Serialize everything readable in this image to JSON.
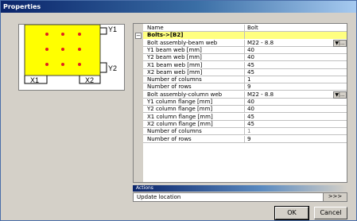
{
  "window": {
    "title": "Properties"
  },
  "diagram": {
    "labels": {
      "y1": "Y1",
      "y2": "Y2",
      "x1": "X1",
      "x2": "X2"
    },
    "colors": {
      "plate": "#ffff00",
      "bolt": "#e02020"
    }
  },
  "properties": {
    "header": {
      "name": "Name",
      "value": "Bolt"
    },
    "rows": [
      {
        "name": "Bolts->[B2]",
        "value": "",
        "group": true
      },
      {
        "name": "Bolt assembly-beam web",
        "value": "M22 - 8.8",
        "dropdown": true
      },
      {
        "name": "Y1 beam web [mm]",
        "value": "40"
      },
      {
        "name": "Y2 beam web [mm]",
        "value": "40"
      },
      {
        "name": "X1 beam web [mm]",
        "value": "45"
      },
      {
        "name": "X2 beam web [mm]",
        "value": "45"
      },
      {
        "name": "Number of columns",
        "value": "1"
      },
      {
        "name": "Number of rows",
        "value": "9"
      },
      {
        "name": "Bolt assembly-column web",
        "value": "M22 - 8.8",
        "dropdown": true
      },
      {
        "name": "Y1 column flange [mm]",
        "value": "40"
      },
      {
        "name": "Y2 column flange [mm]",
        "value": "40"
      },
      {
        "name": "X1 column flange [mm]",
        "value": "45"
      },
      {
        "name": "X2 column flange [mm]",
        "value": "45"
      },
      {
        "name": "Number of columns",
        "value": "1",
        "muted": true
      },
      {
        "name": "Number of rows",
        "value": "9"
      }
    ],
    "dropdown_label": "▼|..."
  },
  "actions": {
    "header": "Actions",
    "item_label": "Update location",
    "more_label": ">>>"
  },
  "buttons": {
    "ok": "OK",
    "cancel": "Cancel"
  }
}
